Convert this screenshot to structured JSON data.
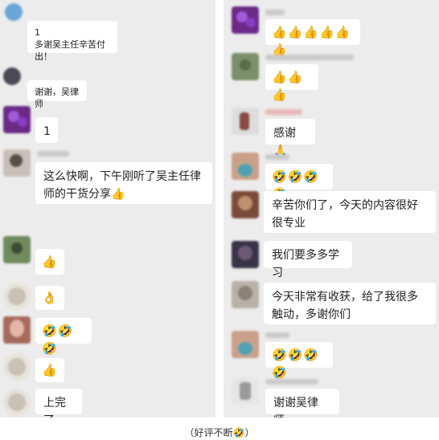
{
  "left": {
    "messages": [
      {
        "text": "1\n多谢吴主任辛苦付出！"
      },
      {
        "text": "谢谢，吴律师"
      },
      {
        "text": "1"
      },
      {
        "text": "这么快啊，下午刚听了吴主任律师的干货分享👍"
      },
      {
        "text": "👍"
      },
      {
        "text": "👌"
      },
      {
        "text": "🤣🤣🤣"
      },
      {
        "text": "👍"
      },
      {
        "text": "上完了"
      }
    ]
  },
  "right": {
    "messages": [
      {
        "text": "👍👍👍👍👍👍"
      },
      {
        "text": "👍👍👍"
      },
      {
        "text": "感谢🙏"
      },
      {
        "text": "🤣🤣🤣🤣"
      },
      {
        "text": "辛苦你们了，今天的内容很好很专业"
      },
      {
        "text": "我们要多多学习"
      },
      {
        "text": "今天非常有收获，给了我很多触动，多谢你们"
      },
      {
        "text": "🤣🤣🤣🤣"
      },
      {
        "text": "谢谢吴律师。"
      }
    ]
  },
  "caption": {
    "text": "（好评不断",
    "emoji": "🤣",
    "close": "）"
  },
  "colors": {
    "background": "#ececec",
    "bubble": "#ffffff",
    "emoji": "#e3a640"
  }
}
